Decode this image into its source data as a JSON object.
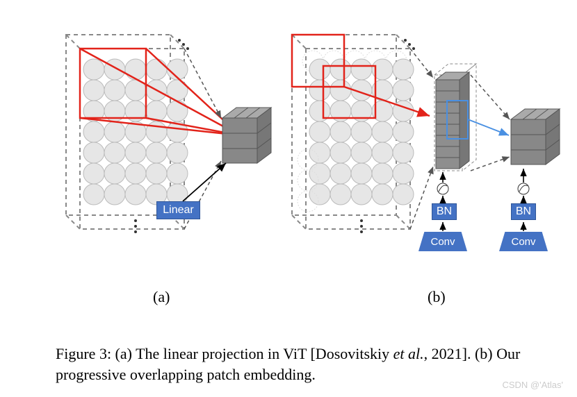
{
  "labels": {
    "linear": "Linear",
    "bn1": "BN",
    "bn2": "BN",
    "conv1": "Conv",
    "conv2": "Conv",
    "sub_a": "(a)",
    "sub_b": "(b)"
  },
  "caption": {
    "prefix": "Figure 3: (a) The linear projection in ViT [Dosovitskiy ",
    "italic": "et al.",
    "suffix": ", 2021]. (b) Our progressive overlapping patch embedding."
  },
  "watermark": "CSDN @'Atlas'"
}
